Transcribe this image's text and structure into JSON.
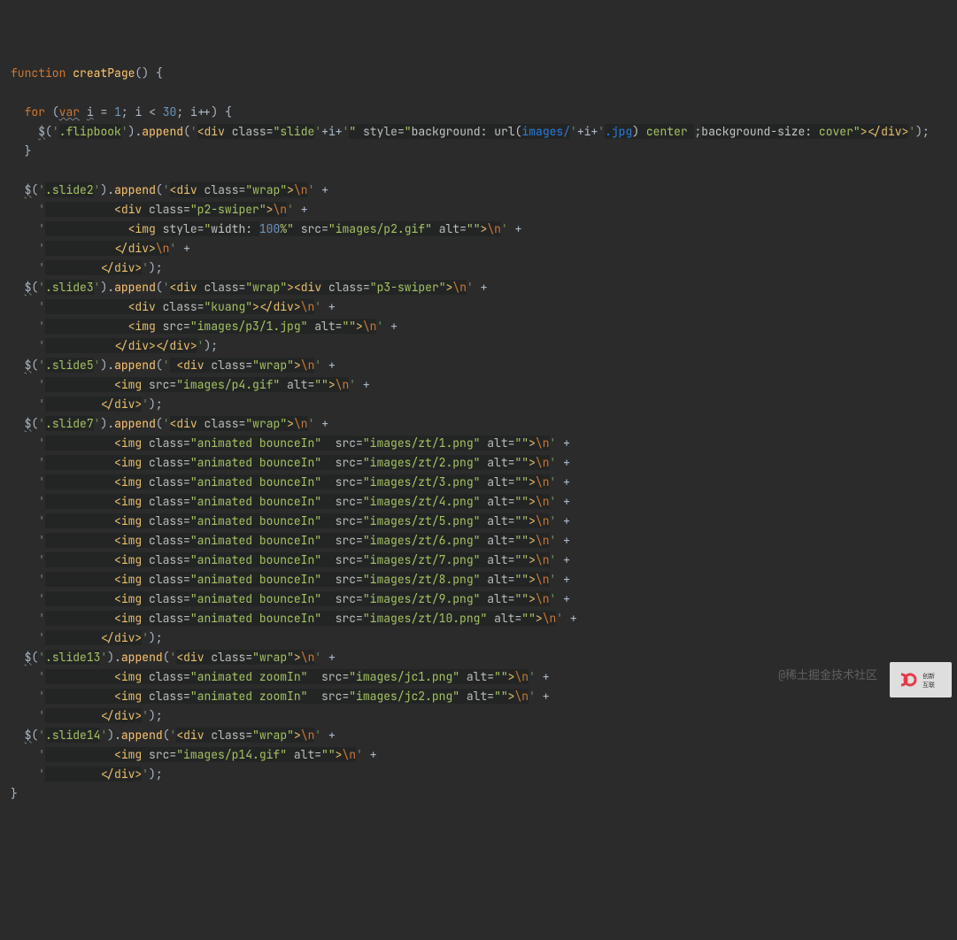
{
  "code": {
    "fnKeyword": "function",
    "fnName": "creatPage",
    "for": {
      "kw": "for",
      "varkw": "var",
      "i": "i",
      "eq": "=",
      "one": "1",
      "lt": "<",
      "limit": "30",
      "inc": "i++"
    },
    "jq": "$",
    "flipbookSel": ".flipbook",
    "append": "append",
    "slideOpen": "<div",
    "classAttr": "class",
    "slideClass": "slide",
    "styleAttr": "style",
    "bgProp": "background",
    "urlFn": "url",
    "imagesPath": "images/",
    "jpgExt": ".jpg",
    "center": "center",
    "bgSizeProp": "background-size",
    "cover": "cover",
    "closeDiv": "></div>",
    "s2": {
      "sel": ".slide2",
      "wrap": "<div",
      "wrapClass": "wrap",
      "nl": "\\n",
      "p2div": "<div",
      "p2class": "p2-swiper",
      "img": "<img",
      "imgStyle": "width:",
      "imgW": "100",
      "pct": "%",
      "src": "src",
      "srcVal": "images/p2.gif",
      "alt": "alt",
      "close1": "</div>",
      "close2": "</div>"
    },
    "s3": {
      "sel": ".slide3",
      "wrapClass": "wrap",
      "p3class": "p3-swiper",
      "kuang": "kuang",
      "divclose": "></div>",
      "imgSrc": "images/p3/1.jpg",
      "close": "</div></div>"
    },
    "s5": {
      "sel": ".slide5",
      "wrapClass": "wrap",
      "imgSrc": "images/p4.gif",
      "close": "</div>"
    },
    "s7": {
      "sel": ".slide7",
      "wrapClass": "wrap",
      "imgClass": "animated bounceIn",
      "srcs": [
        "images/zt/1.png",
        "images/zt/2.png",
        "images/zt/3.png",
        "images/zt/4.png",
        "images/zt/5.png",
        "images/zt/6.png",
        "images/zt/7.png",
        "images/zt/8.png",
        "images/zt/9.png",
        "images/zt/10.png"
      ],
      "close": "</div>"
    },
    "s13": {
      "sel": ".slide13",
      "wrapClass": "wrap",
      "imgClass": "animated zoomIn",
      "src1": "images/jc1.png",
      "src2": "images/jc2.png",
      "close": "</div>"
    },
    "s14": {
      "sel": ".slide14",
      "wrapClass": "wrap",
      "imgSrc": "images/p14.gif",
      "close": "</div>"
    }
  },
  "watermark": "@稀土掘金技术社区",
  "logoText": "创新互联"
}
